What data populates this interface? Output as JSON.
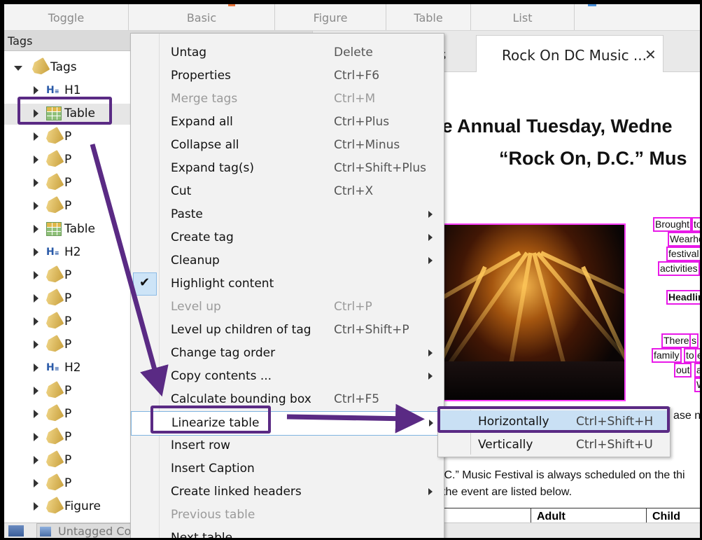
{
  "toolbar": {
    "tabs": [
      "Toggle",
      "Basic",
      "Figure",
      "Table",
      "List"
    ],
    "accent": "#5a2a84"
  },
  "tags_panel": {
    "title": "Tags",
    "root": "Tags",
    "items": [
      {
        "label": "H1",
        "icon": "heading-icon"
      },
      {
        "label": "Table",
        "icon": "table-icon"
      },
      {
        "label": "P",
        "icon": "tag-icon"
      },
      {
        "label": "P",
        "icon": "tag-icon"
      },
      {
        "label": "P",
        "icon": "tag-icon"
      },
      {
        "label": "P",
        "icon": "tag-icon"
      },
      {
        "label": "Table",
        "icon": "table-icon"
      },
      {
        "label": "H2",
        "icon": "heading-icon"
      },
      {
        "label": "P",
        "icon": "tag-icon"
      },
      {
        "label": "P",
        "icon": "tag-icon"
      },
      {
        "label": "P",
        "icon": "tag-icon"
      },
      {
        "label": "P",
        "icon": "tag-icon"
      },
      {
        "label": "H2",
        "icon": "heading-icon"
      },
      {
        "label": "P",
        "icon": "tag-icon"
      },
      {
        "label": "P",
        "icon": "tag-icon"
      },
      {
        "label": "P",
        "icon": "tag-icon"
      },
      {
        "label": "P",
        "icon": "tag-icon"
      },
      {
        "label": "P",
        "icon": "tag-icon"
      },
      {
        "label": "Figure",
        "icon": "tag-icon"
      }
    ]
  },
  "bottom_bar": {
    "tab": "Untagged Co"
  },
  "doc": {
    "tabs": [
      {
        "label": "s"
      },
      {
        "label": "Rock On DC Music ...",
        "close": "✕"
      }
    ],
    "heading_line1": "he Annual Tuesday, Wedne",
    "heading_line2": "“Rock On, D.C.” Mus",
    "side_texts": [
      "Brought",
      "to",
      "Wearho",
      "festival",
      "activities",
      "Headlin",
      "There",
      "s",
      "family",
      "to",
      "e",
      "out",
      "an",
      "W"
    ],
    "caption_tail": "ase n",
    "body_line1": ".C.” Music Festival is always scheduled on the thi",
    "body_line2": "the event are listed below.",
    "table_headers": [
      "Adult",
      "Child"
    ]
  },
  "menu": {
    "items": [
      {
        "label": "Untag",
        "shortcut": "Delete"
      },
      {
        "label": "Properties",
        "shortcut": "Ctrl+F6"
      },
      {
        "label": "Merge tags",
        "shortcut": "Ctrl+M",
        "disabled": true
      },
      {
        "label": "Expand all",
        "shortcut": "Ctrl+Plus"
      },
      {
        "label": "Collapse all",
        "shortcut": "Ctrl+Minus"
      },
      {
        "label": "Expand tag(s)",
        "shortcut": "Ctrl+Shift+Plus"
      },
      {
        "label": "Cut",
        "shortcut": "Ctrl+X"
      },
      {
        "label": "Paste",
        "shortcut": "",
        "submenu": true
      },
      {
        "label": "Create tag",
        "shortcut": "",
        "submenu": true
      },
      {
        "label": "Cleanup",
        "shortcut": "",
        "submenu": true
      },
      {
        "label": "Highlight content",
        "shortcut": "",
        "checked": true
      },
      {
        "label": "Level up",
        "shortcut": "Ctrl+P",
        "disabled": true
      },
      {
        "label": "Level up children of tag",
        "shortcut": "Ctrl+Shift+P"
      },
      {
        "label": "Change tag order",
        "shortcut": "",
        "submenu": true
      },
      {
        "label": "Copy contents ...",
        "shortcut": "",
        "submenu": true
      },
      {
        "label": "Calculate bounding box",
        "shortcut": "Ctrl+F5"
      },
      {
        "label": "Linearize table",
        "shortcut": "",
        "submenu": true,
        "hover": true
      },
      {
        "label": "Insert row",
        "shortcut": ""
      },
      {
        "label": "Insert Caption",
        "shortcut": ""
      },
      {
        "label": "Create linked headers",
        "shortcut": "",
        "submenu": true
      },
      {
        "label": "Previous table",
        "shortcut": "",
        "disabled": true
      },
      {
        "label": "Next table",
        "shortcut": ""
      }
    ],
    "check_glyph": "✔"
  },
  "submenu": {
    "items": [
      {
        "label": "Horizontally",
        "shortcut": "Ctrl+Shift+H"
      },
      {
        "label": "Vertically",
        "shortcut": "Ctrl+Shift+U"
      }
    ]
  }
}
